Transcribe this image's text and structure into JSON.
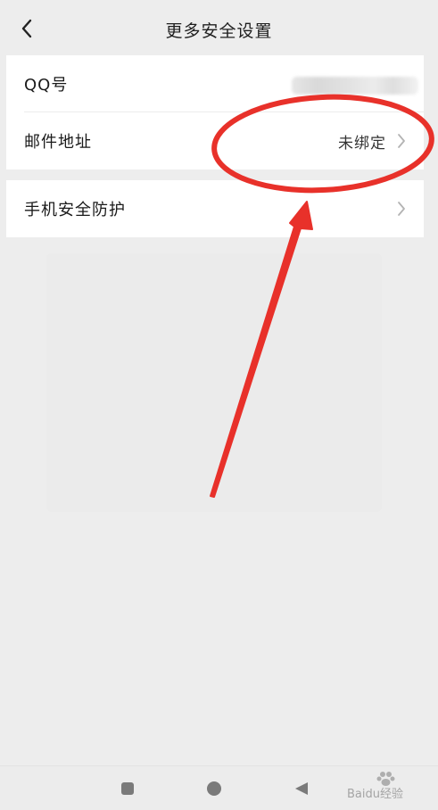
{
  "header": {
    "title": "更多安全设置",
    "back_icon": "chevron-left-icon"
  },
  "security_settings": {
    "qq_number": {
      "label": "QQ号",
      "value_redacted": true
    },
    "email": {
      "label": "邮件地址",
      "value": "未绑定"
    },
    "phone_protection": {
      "label": "手机安全防护"
    }
  },
  "annotation": {
    "color": "#e8312a",
    "shapes": [
      "circle-highlight",
      "arrow"
    ]
  },
  "nav_bar": {
    "icons": [
      "square-icon",
      "circle-icon",
      "triangle-back-icon"
    ]
  },
  "watermark": {
    "brand": "Baidu经验"
  },
  "colors": {
    "background": "#ededed",
    "card": "#ffffff",
    "annotation_red": "#e8312a"
  }
}
